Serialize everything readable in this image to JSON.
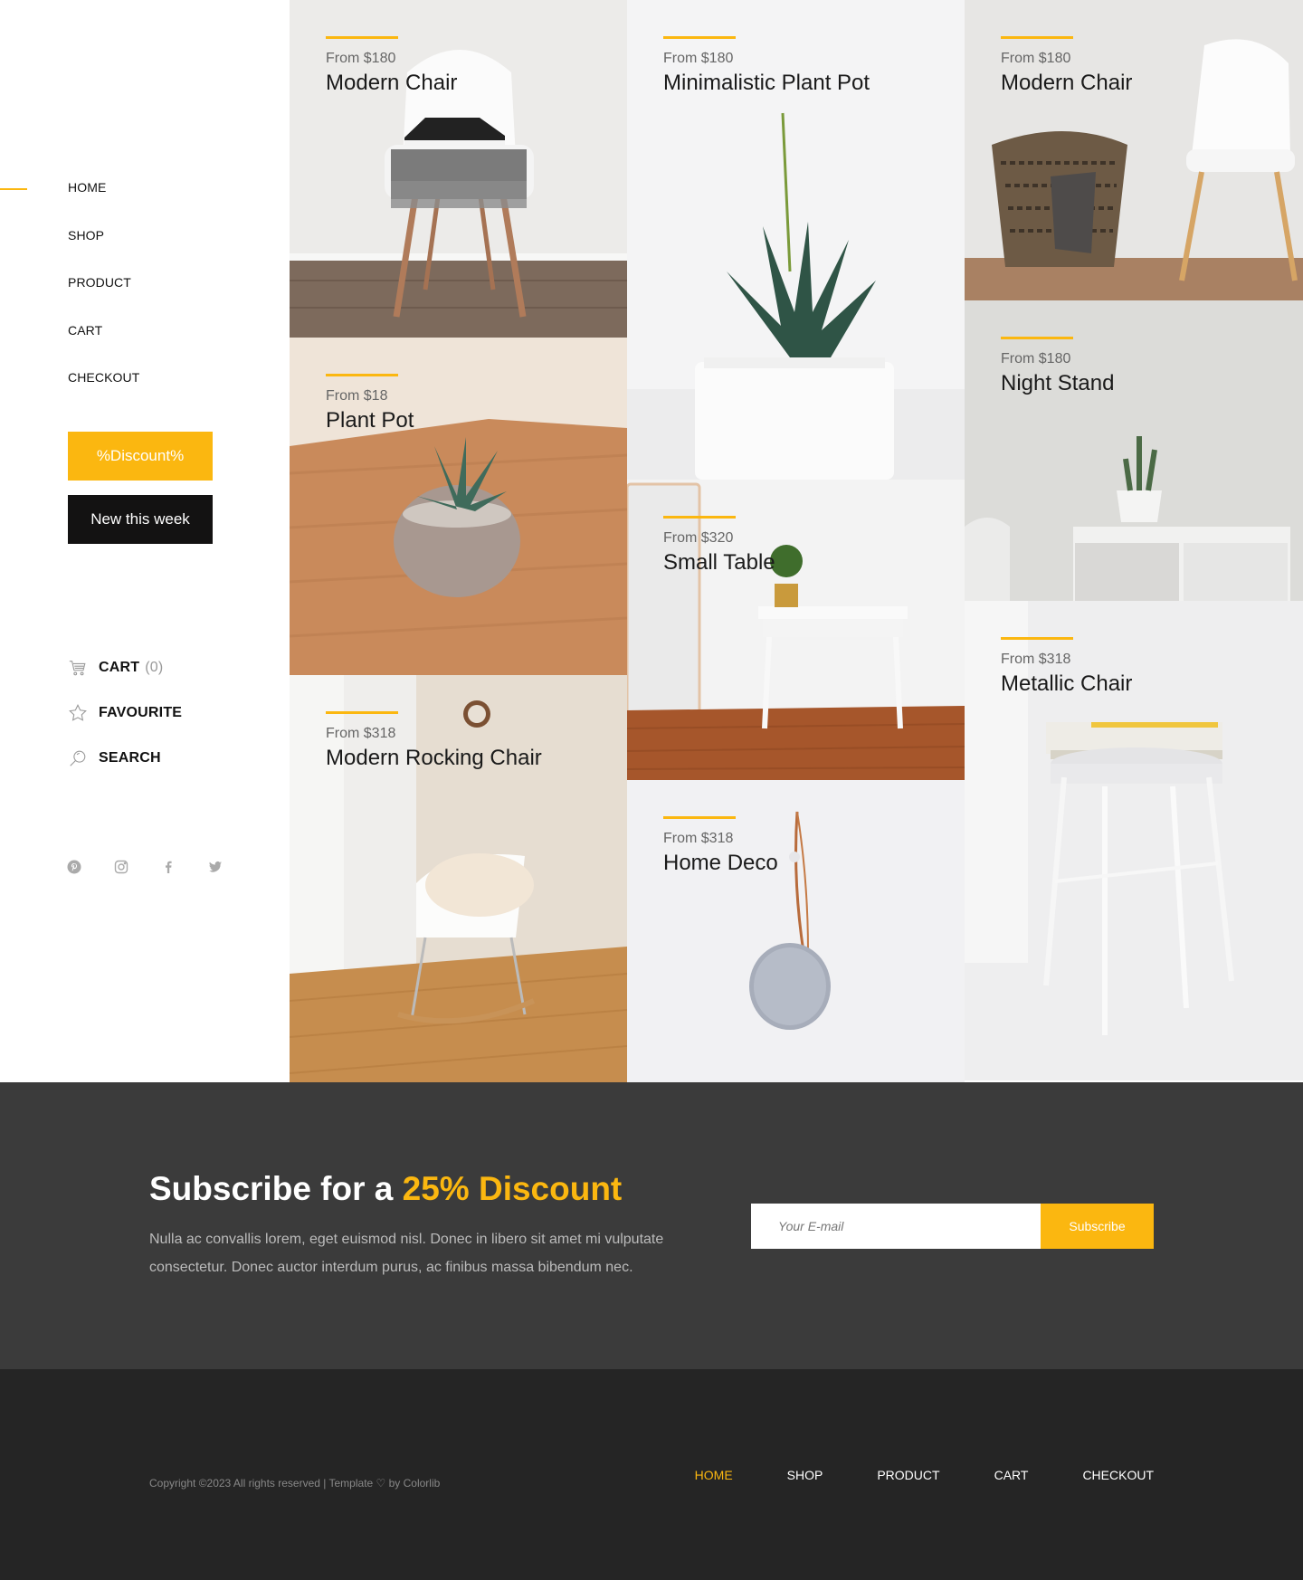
{
  "nav": {
    "items": [
      "HOME",
      "SHOP",
      "PRODUCT",
      "CART",
      "CHECKOUT"
    ],
    "active": "HOME"
  },
  "buttons": {
    "discount": "%Discount%",
    "new_this_week": "New this week"
  },
  "side_links": {
    "cart": "CART",
    "cart_count": "(0)",
    "favourite": "FAVOURITE",
    "search": "SEARCH"
  },
  "social_icons": [
    "pinterest-icon",
    "instagram-icon",
    "facebook-icon",
    "twitter-icon"
  ],
  "products": [
    {
      "price": "From $180",
      "name": "Modern Chair"
    },
    {
      "price": "From $18",
      "name": "Plant Pot"
    },
    {
      "price": "From $318",
      "name": "Modern Rocking Chair"
    },
    {
      "price": "From $180",
      "name": "Minimalistic Plant Pot"
    },
    {
      "price": "From $320",
      "name": "Small Table"
    },
    {
      "price": "From $318",
      "name": "Home Deco"
    },
    {
      "price": "From $180",
      "name": "Modern Chair"
    },
    {
      "price": "From $180",
      "name": "Night Stand"
    },
    {
      "price": "From $318",
      "name": "Metallic Chair"
    }
  ],
  "newsletter": {
    "title_prefix": "Subscribe for a ",
    "title_highlight": "25% Discount",
    "text": "Nulla ac convallis lorem, eget euismod nisl. Donec in libero sit amet mi vulputate consectetur. Donec auctor interdum purus, ac finibus massa bibendum nec.",
    "placeholder": "Your E-mail",
    "button": "Subscribe"
  },
  "footer": {
    "copyright": "Copyright ©2023 All rights reserved | Template ♡ by Colorlib",
    "nav": [
      "HOME",
      "SHOP",
      "PRODUCT",
      "CART",
      "CHECKOUT"
    ]
  },
  "colors": {
    "accent": "#fbb710",
    "dark": "#131212",
    "newsletter_bg": "#3b3b3b",
    "footer_bg": "#252525"
  }
}
